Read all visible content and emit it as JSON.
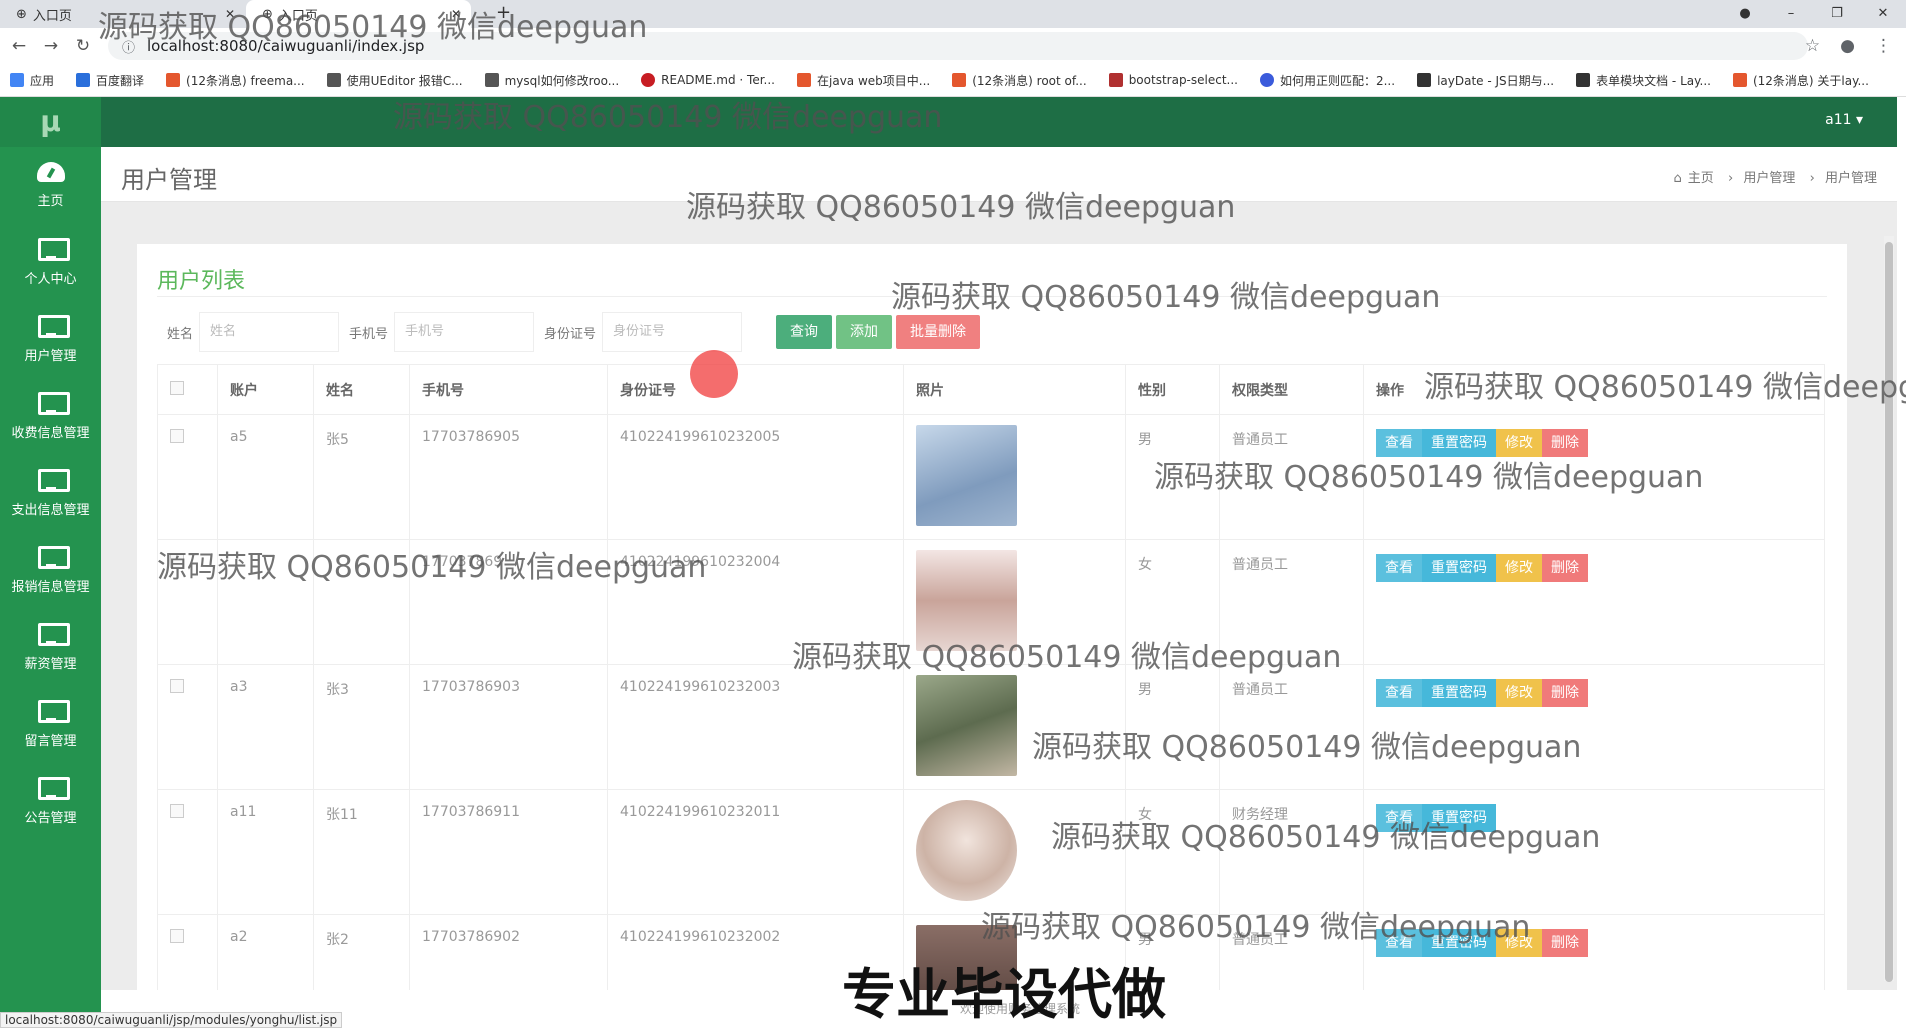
{
  "browser": {
    "tabs": [
      {
        "label": "入口页"
      },
      {
        "label": "入口页"
      }
    ],
    "url": "localhost:8080/caiwuguanli/index.jsp",
    "bookmarks": [
      "应用",
      "百度翻译",
      "(12条消息) freema...",
      "使用UEditor 报错C...",
      "mysql如何修改roo...",
      "README.md · Ter...",
      "在java web项目中...",
      "(12条消息) root of...",
      "bootstrap-select...",
      "如何用正则匹配：2...",
      "layDate - JS日期与...",
      "表单模块文档 - Lay...",
      "(12条消息) 关于lay..."
    ],
    "status_url": "localhost:8080/caiwuguanli/jsp/modules/yonghu/list.jsp"
  },
  "app": {
    "logo": "μ",
    "user": "a11 ▾",
    "nav": [
      {
        "label": "主页",
        "icon": "dashboard-icon"
      },
      {
        "label": "个人中心",
        "icon": "monitor-icon"
      },
      {
        "label": "用户管理",
        "icon": "monitor-icon"
      },
      {
        "label": "收费信息管理",
        "icon": "monitor-icon"
      },
      {
        "label": "支出信息管理",
        "icon": "monitor-icon"
      },
      {
        "label": "报销信息管理",
        "icon": "monitor-icon"
      },
      {
        "label": "薪资管理",
        "icon": "monitor-icon"
      },
      {
        "label": "留言管理",
        "icon": "monitor-icon"
      },
      {
        "label": "公告管理",
        "icon": "monitor-icon"
      }
    ],
    "page_title": "用户管理",
    "breadcrumb": [
      "主页",
      "用户管理",
      "用户管理"
    ]
  },
  "list": {
    "title": "用户列表",
    "search": {
      "name_label": "姓名",
      "name_placeholder": "姓名",
      "phone_label": "手机号",
      "phone_placeholder": "手机号",
      "id_label": "身份证号",
      "id_placeholder": "身份证号",
      "query": "查询",
      "add": "添加",
      "batch_delete": "批量删除"
    },
    "columns": [
      "账户",
      "姓名",
      "手机号",
      "身份证号",
      "照片",
      "性别",
      "权限类型",
      "操作"
    ],
    "rows": [
      {
        "account": "a5",
        "name": "张5",
        "phone": "17703786905",
        "idcard": "410224199610232005",
        "gender": "男",
        "role": "普通员工"
      },
      {
        "account": "",
        "name": "",
        "phone": "177037869",
        "idcard": "410224199610232004",
        "gender": "女",
        "role": "普通员工"
      },
      {
        "account": "a3",
        "name": "张3",
        "phone": "17703786903",
        "idcard": "410224199610232003",
        "gender": "男",
        "role": "普通员工"
      },
      {
        "account": "a11",
        "name": "张11",
        "phone": "17703786911",
        "idcard": "410224199610232011",
        "gender": "女",
        "role": "财务经理"
      },
      {
        "account": "a2",
        "name": "张2",
        "phone": "17703786902",
        "idcard": "410224199610232002",
        "gender": "男",
        "role": "普通员工"
      }
    ],
    "ops": {
      "view": "查看",
      "reset": "重置密码",
      "edit": "修改",
      "delete": "删除"
    }
  },
  "footer": "欢迎使用财务管理系统",
  "watermarks": {
    "text": "源码获取 QQ86050149 微信deepguan",
    "big": "专业毕设代做"
  },
  "colors": {
    "sidebar": "#24934f",
    "topbar": "#1e6e45",
    "view": "#5bc0de",
    "reset": "#46b8da",
    "edit": "#f0c24b",
    "delete": "#f07a7a",
    "query": "#4cae7c",
    "add": "#71c285",
    "batch_delete": "#f08080"
  }
}
